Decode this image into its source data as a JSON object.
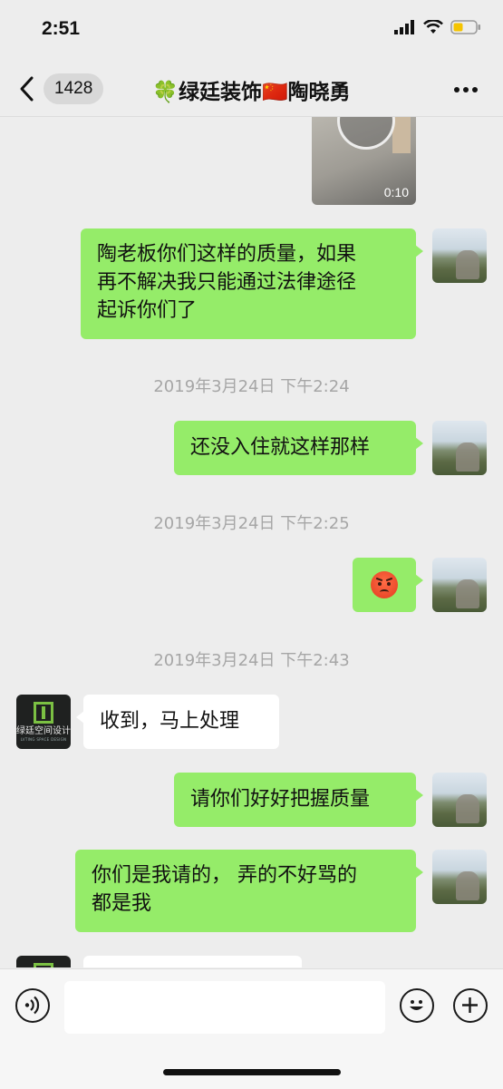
{
  "status_bar": {
    "time": "2:51"
  },
  "nav": {
    "unread_count": "1428",
    "title": "🍀绿廷装饰🇨🇳陶晓勇"
  },
  "messages": {
    "video_duration": "0:10",
    "m1_line1": "陶老板你们这样的质量，如果",
    "m1_line2": "再不解决我只能通过法律途径",
    "m1_line3": "起诉你们了",
    "ts1": "2019年3月24日 下午2:24",
    "m2": "还没入住就这样那样",
    "ts2": "2019年3月24日 下午2:25",
    "m3_emoji": "angry-face",
    "ts3": "2019年3月24日 下午2:43",
    "m4": "收到，马上处理",
    "m5": "请你们好好把握质量",
    "m6_line1": "你们是我请的， 弄的不好骂的",
    "m6_line2": "都是我"
  },
  "contact_avatar": {
    "logo_text": "绿廷空间设计",
    "logo_sub": "LVTING SPACE DESIGN"
  },
  "colors": {
    "background": "#ededed",
    "my_bubble": "#95ec69",
    "their_bubble": "#ffffff"
  }
}
